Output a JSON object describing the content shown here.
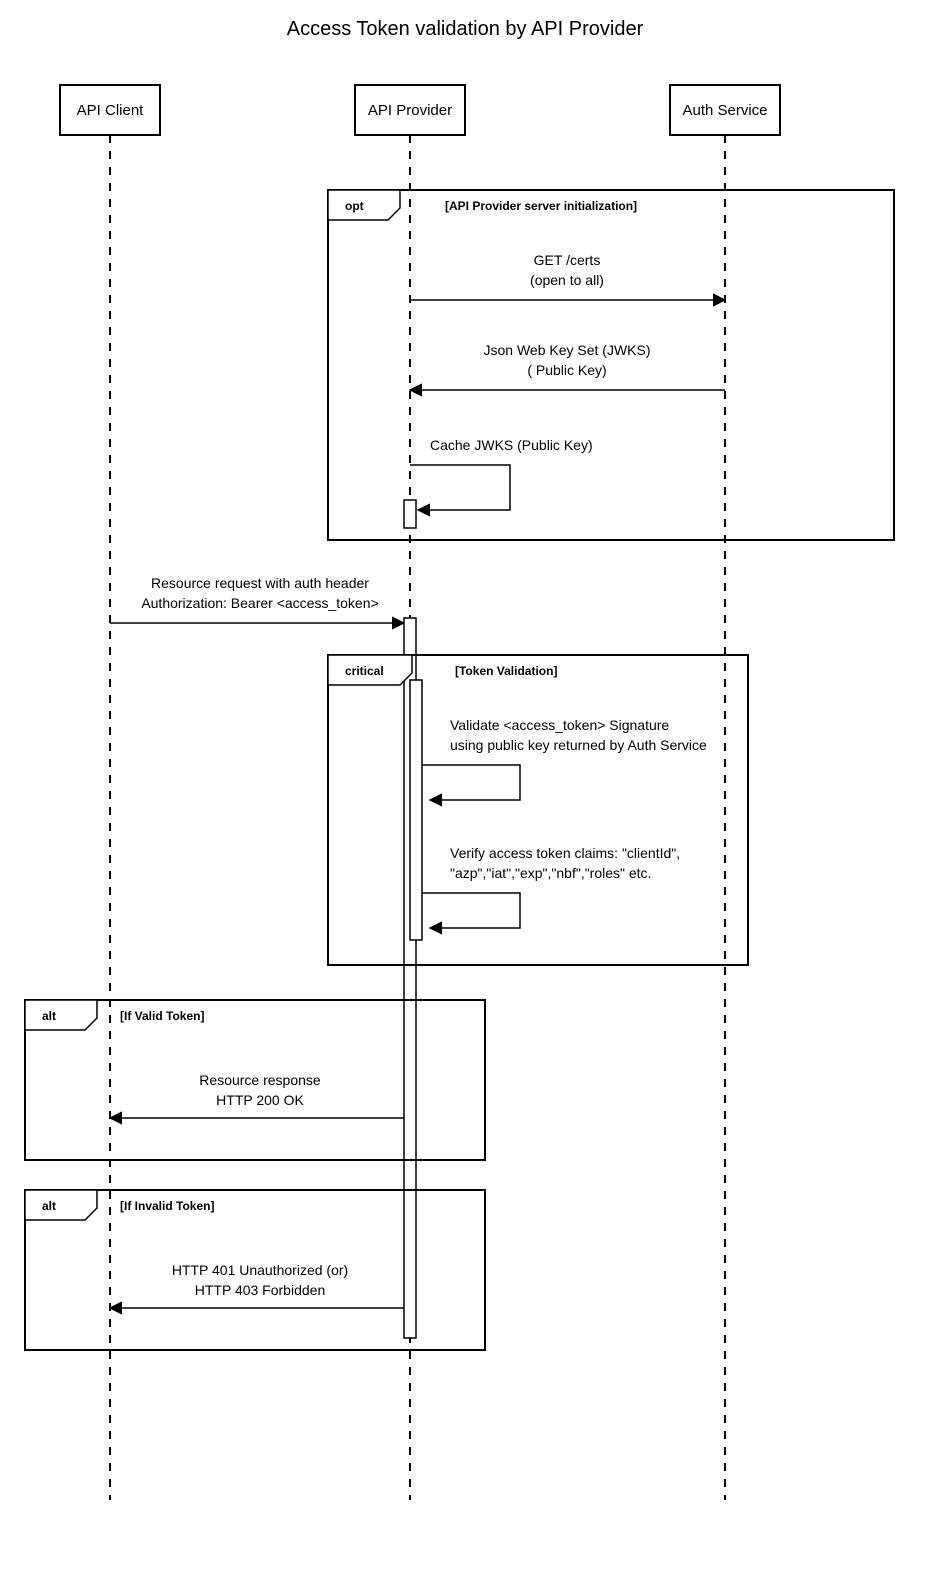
{
  "title": "Access Token validation by API Provider",
  "actors": {
    "client": "API Client",
    "provider": "API Provider",
    "auth": "Auth Service"
  },
  "fragments": {
    "opt": {
      "type": "opt",
      "cond": "[API Provider server initialization]"
    },
    "critical": {
      "type": "critical",
      "cond": "[Token Validation]"
    },
    "alt1": {
      "type": "alt",
      "cond": "[If Valid Token]"
    },
    "alt2": {
      "type": "alt",
      "cond": "[If Invalid Token]"
    }
  },
  "messages": {
    "m1a": "GET /certs",
    "m1b": "(open to all)",
    "m2a": "Json Web Key Set (JWKS)",
    "m2b": "( Public Key)",
    "m3": "Cache JWKS (Public Key)",
    "m4a": "Resource request with auth header",
    "m4b": "Authorization: Bearer <access_token>",
    "m5a": "Validate <access_token> Signature",
    "m5b": "using public key returned by Auth Service",
    "m6a": "Verify access token claims: \"clientId\",",
    "m6b": "\"azp\",\"iat\",\"exp\",\"nbf\",\"roles\" etc.",
    "m7a": "Resource response",
    "m7b": "HTTP 200 OK",
    "m8a": "HTTP 401 Unauthorized (or)",
    "m8b": "HTTP 403 Forbidden"
  }
}
